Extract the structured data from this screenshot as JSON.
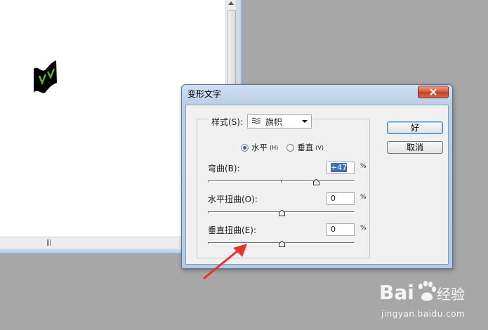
{
  "dialog": {
    "title": "变形文字",
    "style_label": "样式(S):",
    "style_value": "旗帜",
    "orientation": {
      "horizontal_label": "水平",
      "horizontal_key": "(H)",
      "vertical_label": "垂直",
      "vertical_key": "(V)",
      "selected": "horizontal"
    },
    "bend": {
      "label": "弯曲(B):",
      "value": "+47",
      "unit": "%",
      "level_percent": 47
    },
    "h_distort": {
      "label": "水平扭曲(O):",
      "value": "0",
      "unit": "%",
      "level_percent": 0
    },
    "v_distort": {
      "label": "垂直扭曲(E):",
      "value": "0",
      "unit": "%",
      "level_percent": 0
    },
    "ok_label": "好",
    "cancel_label": "取消"
  },
  "document": {
    "hscroll_grip": "|||"
  },
  "watermark": {
    "brand": "Bai 经验",
    "url": "jingyan.baidu.com"
  },
  "colors": {
    "arrow": "#e8322b",
    "selection": "#3b6fb7",
    "glyph_fill": "#000000",
    "glyph_accent": "#5fb233"
  }
}
